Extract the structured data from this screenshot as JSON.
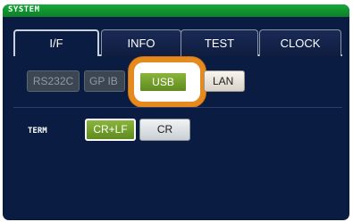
{
  "window": {
    "title": "SYSTEM"
  },
  "tabs": [
    {
      "label": "I/F",
      "active": true
    },
    {
      "label": "INFO",
      "active": false
    },
    {
      "label": "TEST",
      "active": false
    },
    {
      "label": "CLOCK",
      "active": false
    }
  ],
  "interface": {
    "options": [
      {
        "label": "RS232C",
        "state": "disabled"
      },
      {
        "label": "GP IB",
        "state": "disabled"
      },
      {
        "label": "USB",
        "state": "selected"
      },
      {
        "label": "LAN",
        "state": "normal"
      }
    ]
  },
  "term": {
    "label": "TERM",
    "options": [
      {
        "label": "CR+LF",
        "state": "selected"
      },
      {
        "label": "CR",
        "state": "normal"
      }
    ]
  },
  "colors": {
    "background": "#0b1c42",
    "title_bar": "#17a83a",
    "selected": "#7aa531",
    "highlight": "#e48a1e"
  }
}
